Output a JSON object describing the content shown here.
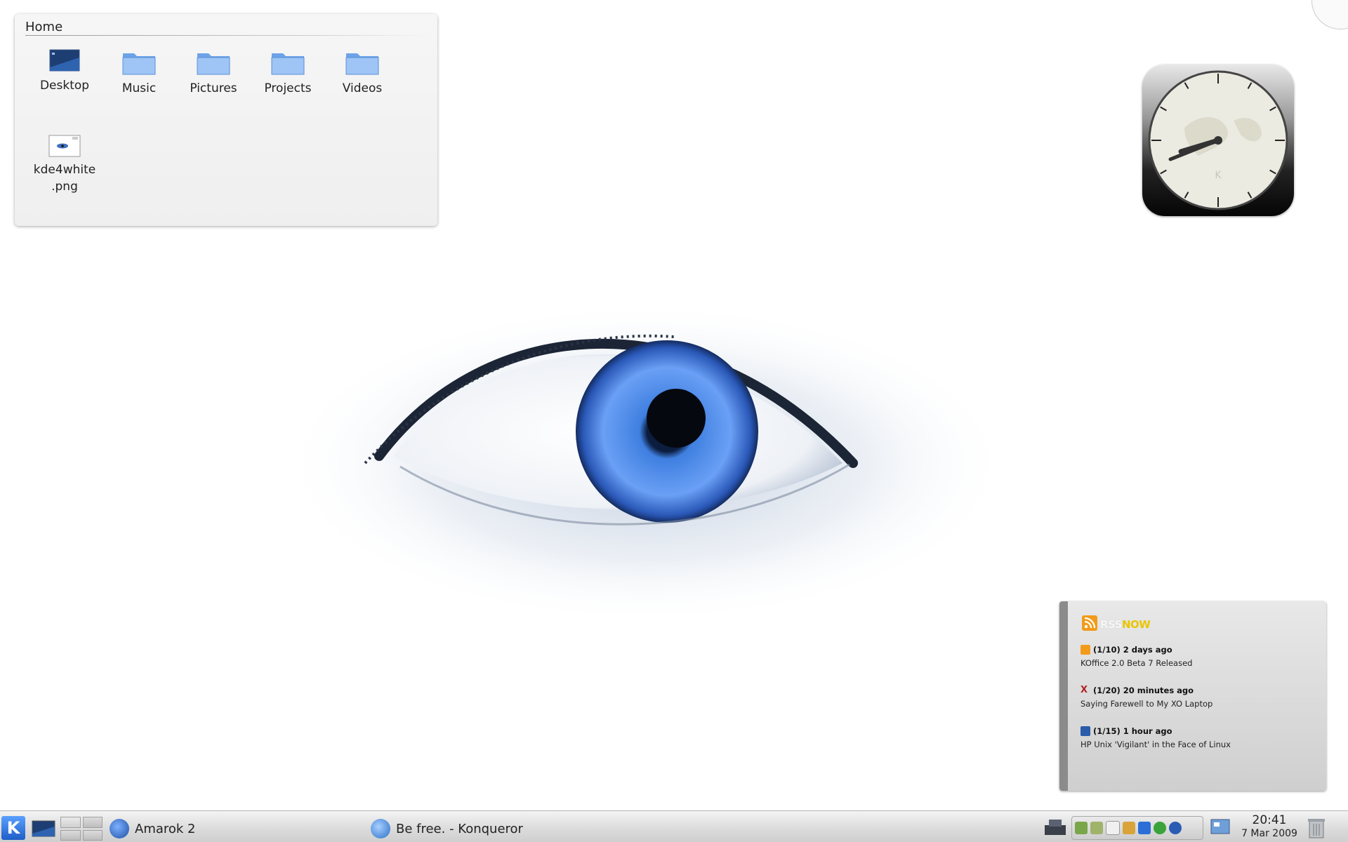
{
  "folder_view": {
    "title": "Home",
    "items": [
      {
        "label": "Desktop",
        "icon": "desktop-icon"
      },
      {
        "label": "Music",
        "icon": "folder-icon"
      },
      {
        "label": "Pictures",
        "icon": "folder-icon"
      },
      {
        "label": "Projects",
        "icon": "folder-icon"
      },
      {
        "label": "Videos",
        "icon": "folder-icon"
      },
      {
        "label": "kde4white\n.png",
        "icon": "image-file-icon"
      }
    ]
  },
  "clock_widget": {
    "time": "20:41"
  },
  "rss_widget": {
    "logo_rss": "RSS",
    "logo_now": "NOW",
    "entries": [
      {
        "head": "(1/10) 2 days ago",
        "title": "KOffice 2.0 Beta 7 Released",
        "icon_color": "#f29b1a"
      },
      {
        "head": "(1/20) 20 minutes ago",
        "title": "Saying Farewell to My XO Laptop",
        "icon_color": "#b22222"
      },
      {
        "head": "(1/15) 1 hour ago",
        "title": "HP Unix 'Vigilant' in the Face of Linux",
        "icon_color": "#2a5caa"
      }
    ]
  },
  "taskbar": {
    "tasks": [
      {
        "label": "Amarok 2"
      },
      {
        "label": "Be free. - Konqueror"
      }
    ],
    "clock": {
      "time": "20:41",
      "date": "7 Mar 2009"
    }
  },
  "colors": {
    "accent": "#2f6fd6",
    "panel": "#dcdcdc"
  }
}
